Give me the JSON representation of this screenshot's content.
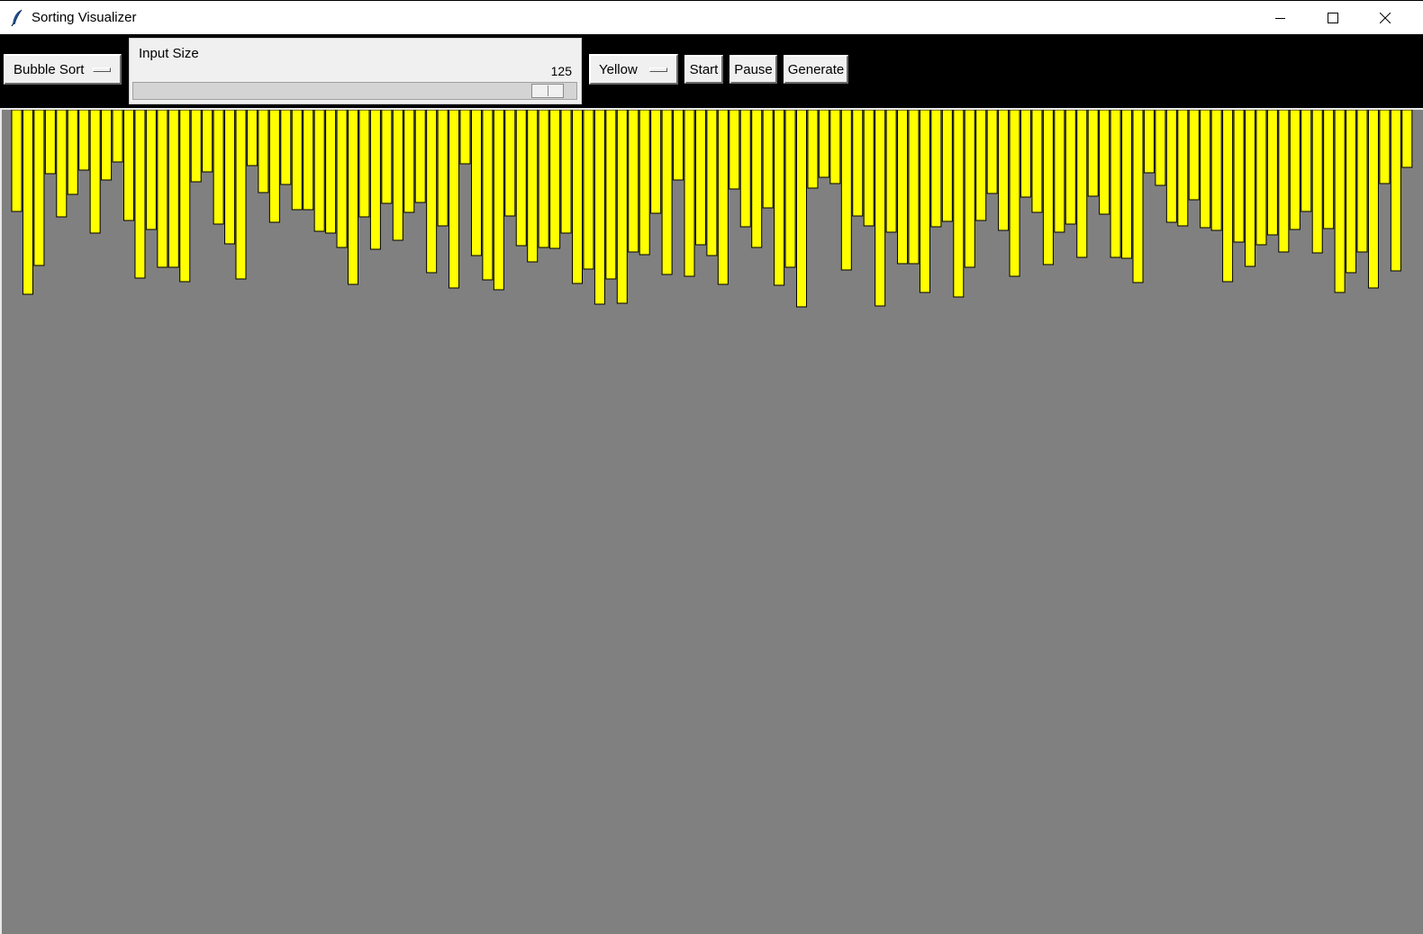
{
  "window": {
    "title": "Sorting Visualizer",
    "icon": "feather-icon",
    "controls": [
      "minimize-icon",
      "maximize-icon",
      "close-icon"
    ]
  },
  "toolbar": {
    "algorithm": {
      "selected": "Bubble Sort"
    },
    "input_size": {
      "label": "Input Size",
      "value": "125",
      "fraction": 0.97
    },
    "color": {
      "selected": "Yellow"
    },
    "start_label": "Start",
    "pause_label": "Pause",
    "generate_label": "Generate"
  },
  "colors": {
    "bar_fill": "#ffff00",
    "bar_stroke": "#000000",
    "canvas_bg": "#808080",
    "toolbar_bg": "#000000"
  },
  "chart_data": {
    "type": "bar",
    "count": 125,
    "values": [
      113,
      205,
      173,
      71,
      119,
      94,
      67,
      137,
      78,
      58,
      123,
      187,
      133,
      175,
      175,
      191,
      80,
      69,
      127,
      149,
      188,
      62,
      92,
      125,
      83,
      111,
      111,
      135,
      137,
      153,
      194,
      119,
      155,
      104,
      145,
      114,
      103,
      181,
      129,
      198,
      60,
      162,
      189,
      200,
      118,
      151,
      169,
      153,
      154,
      137,
      193,
      177,
      216,
      188,
      215,
      158,
      161,
      115,
      183,
      78,
      185,
      150,
      162,
      194,
      88,
      130,
      153,
      109,
      195,
      175,
      219,
      87,
      75,
      82,
      178,
      118,
      129,
      218,
      136,
      171,
      171,
      203,
      130,
      124,
      208,
      175,
      123,
      93,
      134,
      185,
      97,
      114,
      172,
      136,
      127,
      164,
      96,
      116,
      164,
      165,
      192,
      70,
      84,
      125,
      129,
      100,
      131,
      134,
      191,
      147,
      174,
      150,
      139,
      158,
      133,
      113,
      159,
      132,
      203,
      181,
      158,
      198,
      82,
      179,
      64
    ]
  }
}
